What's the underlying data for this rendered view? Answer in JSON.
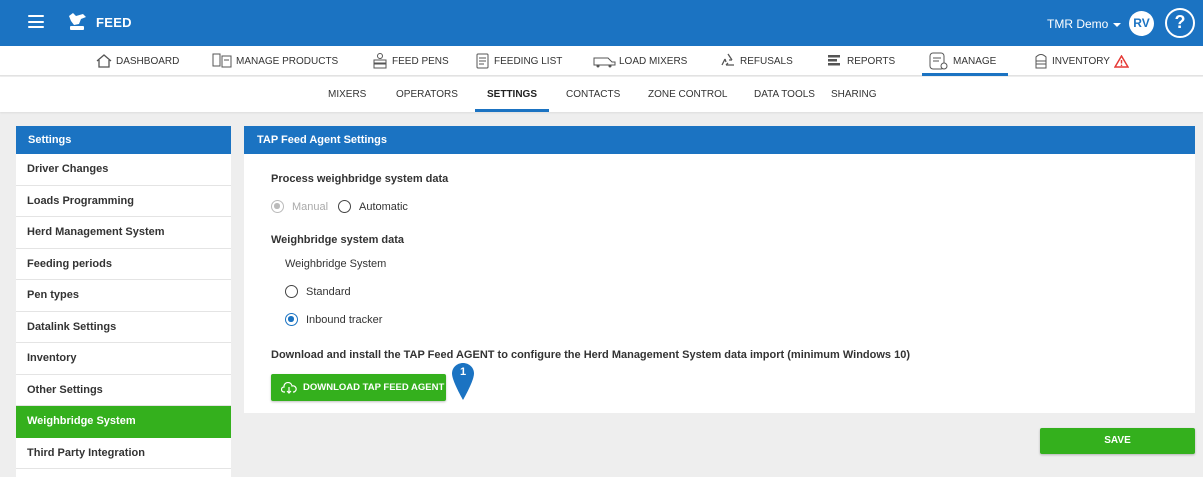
{
  "app": {
    "title": "FEED"
  },
  "account": {
    "name": "TMR Demo",
    "initials": "RV",
    "help": "?"
  },
  "colors": {
    "primary": "#1b73c2",
    "accent_green": "#34b01d",
    "warning": "#e53935"
  },
  "main_nav": [
    {
      "label": "DASHBOARD",
      "icon": "home-icon"
    },
    {
      "label": "MANAGE PRODUCTS",
      "icon": "products-icon"
    },
    {
      "label": "FEED PENS",
      "icon": "feed-pens-icon"
    },
    {
      "label": "FEEDING LIST",
      "icon": "list-icon"
    },
    {
      "label": "LOAD MIXERS",
      "icon": "mixer-truck-icon"
    },
    {
      "label": "REFUSALS",
      "icon": "recycle-icon"
    },
    {
      "label": "REPORTS",
      "icon": "reports-icon"
    },
    {
      "label": "MANAGE",
      "icon": "manage-settings-icon",
      "active": true
    },
    {
      "label": "INVENTORY",
      "icon": "silo-icon",
      "warning": true
    }
  ],
  "sub_nav": [
    {
      "label": "MIXERS"
    },
    {
      "label": "OPERATORS"
    },
    {
      "label": "SETTINGS",
      "active": true
    },
    {
      "label": "CONTACTS"
    },
    {
      "label": "ZONE CONTROL"
    },
    {
      "label": "DATA TOOLS"
    },
    {
      "label": "SHARING"
    }
  ],
  "sidebar": {
    "title": "Settings",
    "items": [
      {
        "label": "Driver Changes"
      },
      {
        "label": "Loads Programming"
      },
      {
        "label": "Herd Management System"
      },
      {
        "label": "Feeding periods"
      },
      {
        "label": "Pen types"
      },
      {
        "label": "Datalink Settings"
      },
      {
        "label": "Inventory"
      },
      {
        "label": "Other Settings"
      },
      {
        "label": "Weighbridge System",
        "active": true
      },
      {
        "label": "Third Party Integration"
      }
    ]
  },
  "panel": {
    "title": "TAP Feed Agent Settings",
    "process_heading": "Process weighbridge system data",
    "process_options": {
      "manual": "Manual",
      "automatic": "Automatic"
    },
    "data_heading": "Weighbridge system data",
    "system_label": "Weighbridge System",
    "system_options": {
      "standard": "Standard",
      "inbound": "Inbound tracker"
    },
    "download_text": "Download and install the TAP Feed AGENT to configure the Herd Management System data import (minimum Windows 10)",
    "download_button": "DOWNLOAD TAP FEED AGENT",
    "marker": "1"
  },
  "save_button": "SAVE"
}
